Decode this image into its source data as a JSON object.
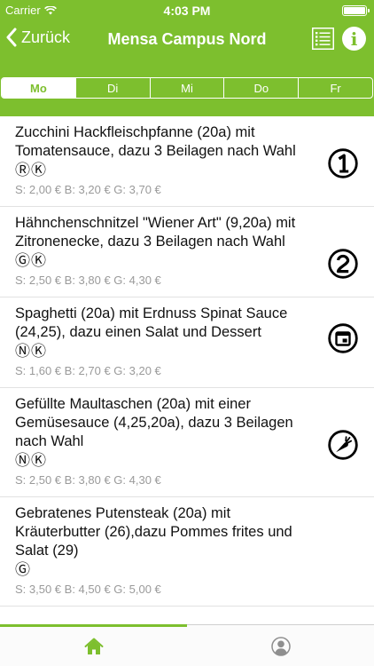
{
  "status_bar": {
    "carrier": "Carrier",
    "time": "4:03 PM"
  },
  "nav": {
    "back_label": "Zurück",
    "title": "Mensa Campus Nord"
  },
  "days": [
    {
      "label": "Mo",
      "active": true
    },
    {
      "label": "Di",
      "active": false
    },
    {
      "label": "Mi",
      "active": false
    },
    {
      "label": "Do",
      "active": false
    },
    {
      "label": "Fr",
      "active": false
    }
  ],
  "meals": [
    {
      "name": "Zucchini Hackfleischpfanne (20a) mit Tomatensauce, dazu 3 Beilagen nach Wahl",
      "marks": "ⓇⓀ",
      "price": "S: 2,00 € B: 3,20 € G: 3,70 €",
      "badge_icon": "menu-number-1-icon"
    },
    {
      "name": "Hähnchenschnitzel \"Wiener Art\" (9,20a) mit Zitronenecke, dazu 3 Beilagen nach Wahl",
      "marks": "ⒼⓀ",
      "price": "S: 2,50 € B: 3,80 € G: 4,30 €",
      "badge_icon": "menu-number-2-icon"
    },
    {
      "name": "Spaghetti (20a) mit Erdnuss Spinat Sauce (24,25), dazu einen Salat und Dessert",
      "marks": "ⓃⓀ",
      "price": "S: 1,60 € B: 2,70 € G: 3,20 €",
      "badge_icon": "daily-special-icon"
    },
    {
      "name": "Gefüllte Maultaschen (20a) mit einer Gemüsesauce (4,25,20a), dazu 3 Beilagen nach Wahl",
      "marks": "ⓃⓀ",
      "price": "S: 2,50 € B: 3,80 € G: 4,30 €",
      "badge_icon": "vegetarian-carrot-icon"
    },
    {
      "name": "Gebratenes Putensteak (20a) mit Kräuterbutter (26),dazu Pommes frites und Salat (29)",
      "marks": "Ⓖ",
      "price": "S: 3,50 € B: 4,50 € G: 5,00 €",
      "badge_icon": ""
    }
  ],
  "tabs": [
    {
      "icon": "home-icon",
      "active": true
    },
    {
      "icon": "profile-icon",
      "active": false
    }
  ],
  "colors": {
    "accent": "#7dbf2e",
    "price_gray": "#9a9a9a",
    "inactive_tab": "#8f8f8f"
  }
}
